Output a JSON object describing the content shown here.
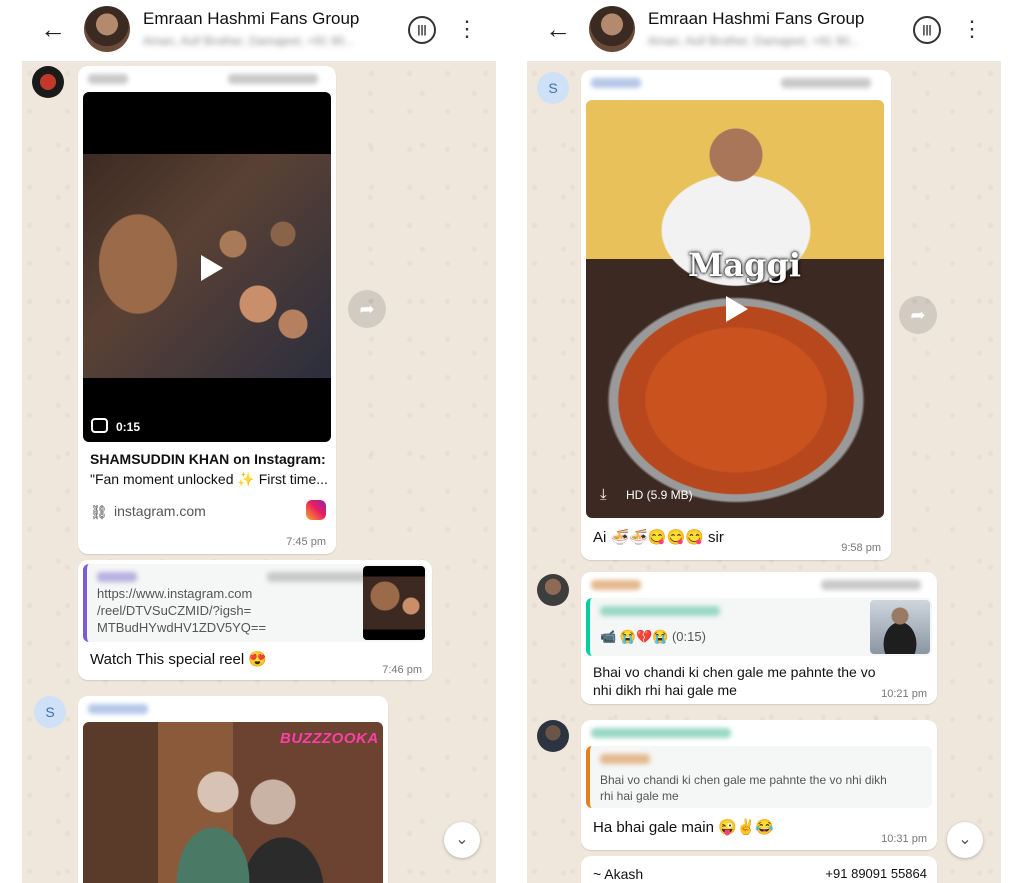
{
  "header": {
    "title": "Emraan Hashmi Fans Group",
    "subtitle": "Aman, Asif Brother, Damajeet, +91 90..."
  },
  "left": {
    "video_duration": "0:15",
    "link_title_line1": "SHAMSUDDIN KHAN on Instagram:",
    "link_title_line2": "\"Fan moment unlocked ✨ First time...",
    "link_domain": "instagram.com",
    "msg1_time": "7:45 pm",
    "quoted_url_line1": "https://www.instagram.com",
    "quoted_url_line2": "/reel/DTVSuCZMID/?igsh=",
    "quoted_url_line3": "MTBudHYwdHV1ZDV5YQ==",
    "msg2_text": "Watch This special reel 😍",
    "msg2_time": "7:46 pm",
    "avatar3_letter": "S",
    "sticker_text": "BUZZZOOKA"
  },
  "right": {
    "avatar1_letter": "S",
    "video_overlay": "Maggi",
    "video_size": "HD (5.9 MB)",
    "msg1_text": "Ai 🍜🍜😋😋😋 sir",
    "msg1_time": "9:58 pm",
    "reply_meta": "📹 😭💔😭 (0:15)",
    "msg2_line1": "Bhai vo chandi ki chen gale me pahnte the vo",
    "msg2_line2": "nhi dikh rhi hai gale me",
    "msg2_time": "10:21 pm",
    "quote_line1": "Bhai vo chandi ki chen gale me pahnte the vo nhi dikh",
    "quote_line2": "rhi hai gale me",
    "msg3_text": "Ha bhai gale main 😜✌️😂",
    "msg3_time": "10:31 pm",
    "contact_name": "~ Akash",
    "contact_phone": "+91 89091 55864"
  },
  "icons": {
    "back": "back-arrow-icon",
    "call": "voice-call-icon",
    "menu": "more-vert-icon",
    "forward": "forward-icon",
    "scroll": "scroll-down-icon",
    "play": "play-icon",
    "link": "link-icon",
    "instagram": "instagram-icon",
    "download": "download-icon",
    "reels": "reels-icon"
  },
  "colors": {
    "accent_green": "#25a0e0",
    "quote_bar_purple": "#7b5cd6",
    "quote_bar_teal": "#06cf9c",
    "quote_bar_orange": "#e67e22",
    "chat_bg": "#efe7dc"
  }
}
